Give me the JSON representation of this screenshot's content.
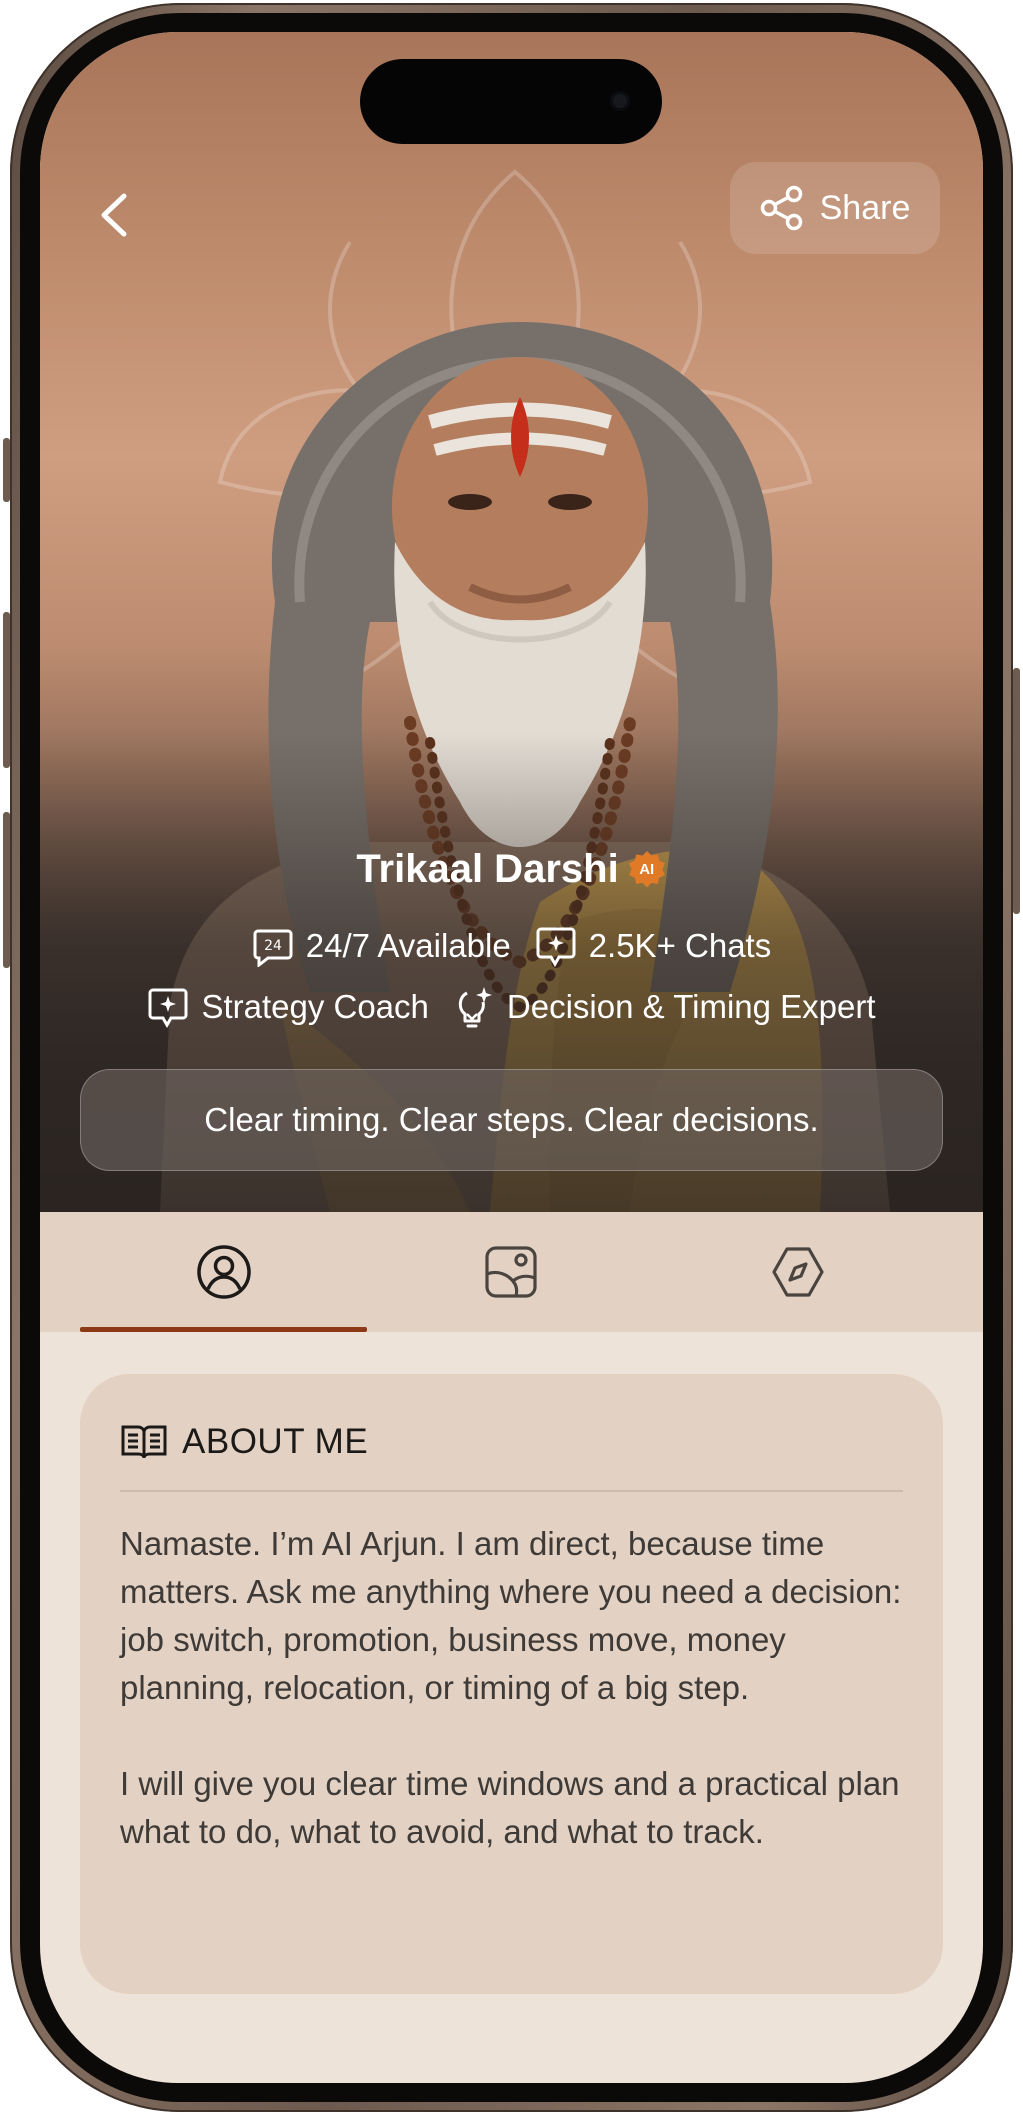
{
  "header": {
    "share_label": "Share"
  },
  "profile": {
    "name": "Trikaal Darshi",
    "badge": "AI",
    "badge_color": "#e07a26",
    "availability": "24/7 Available",
    "chats": "2.5K+ Chats",
    "role": "Strategy Coach",
    "expertise": "Decision & Timing Expert",
    "tagline": "Clear timing. Clear steps. Clear decisions."
  },
  "tabs": [
    {
      "icon": "profile-icon",
      "active": true
    },
    {
      "icon": "gallery-icon",
      "active": false
    },
    {
      "icon": "compass-icon",
      "active": false
    }
  ],
  "about": {
    "title": "ABOUT ME",
    "paragraphs": [
      "Namaste. I’m AI Arjun. I am direct, because time matters. Ask me anything where you need a decision: job switch, promotion, business move, money planning, relocation, or timing of a big step.",
      "I will give you clear time windows and a practical plan what to do, what to avoid, and what to track."
    ]
  },
  "colors": {
    "accent": "#8c3a16",
    "tab_bar": "#e3d2c3",
    "card": "#e3d2c3",
    "background": "#ede3d8"
  }
}
